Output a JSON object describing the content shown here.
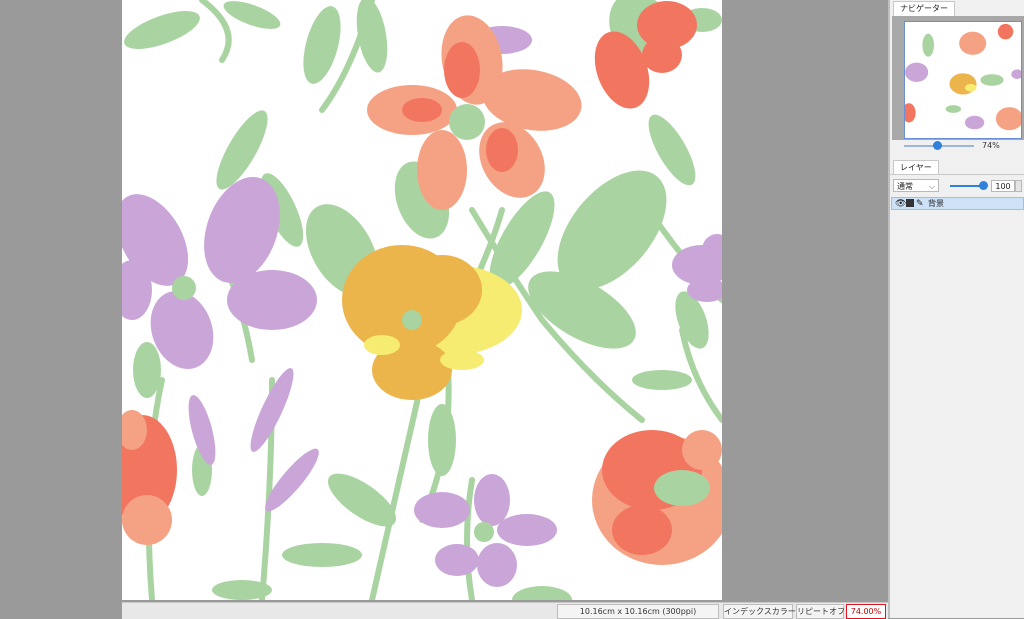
{
  "status_bar": {
    "canvas_size": "10.16cm x 10.16cm (300ppi)",
    "index_color": "インデックスカラー",
    "repeat": "リピートオフ",
    "zoom": "74.00%"
  },
  "navigator": {
    "tab": "ナビゲーター",
    "zoom": "74%",
    "zoom_level": 0.74
  },
  "layers": {
    "tab": "レイヤー",
    "blend_mode": "通常",
    "opacity": "100",
    "opacity_level": 1.0,
    "items": [
      {
        "name": "背景",
        "icons": [
          "eye-icon",
          "mask-icon",
          "pen-icon"
        ]
      }
    ]
  },
  "colors": {
    "leaf": "#a9d4a1",
    "lilac": "#c9a5d8",
    "coral": "#f27560",
    "salmon": "#f5a284",
    "yellow": "#f5ec71",
    "orange": "#ebb54c",
    "selected": "#cde1f7",
    "zoom_highlight": "#e0141e"
  }
}
